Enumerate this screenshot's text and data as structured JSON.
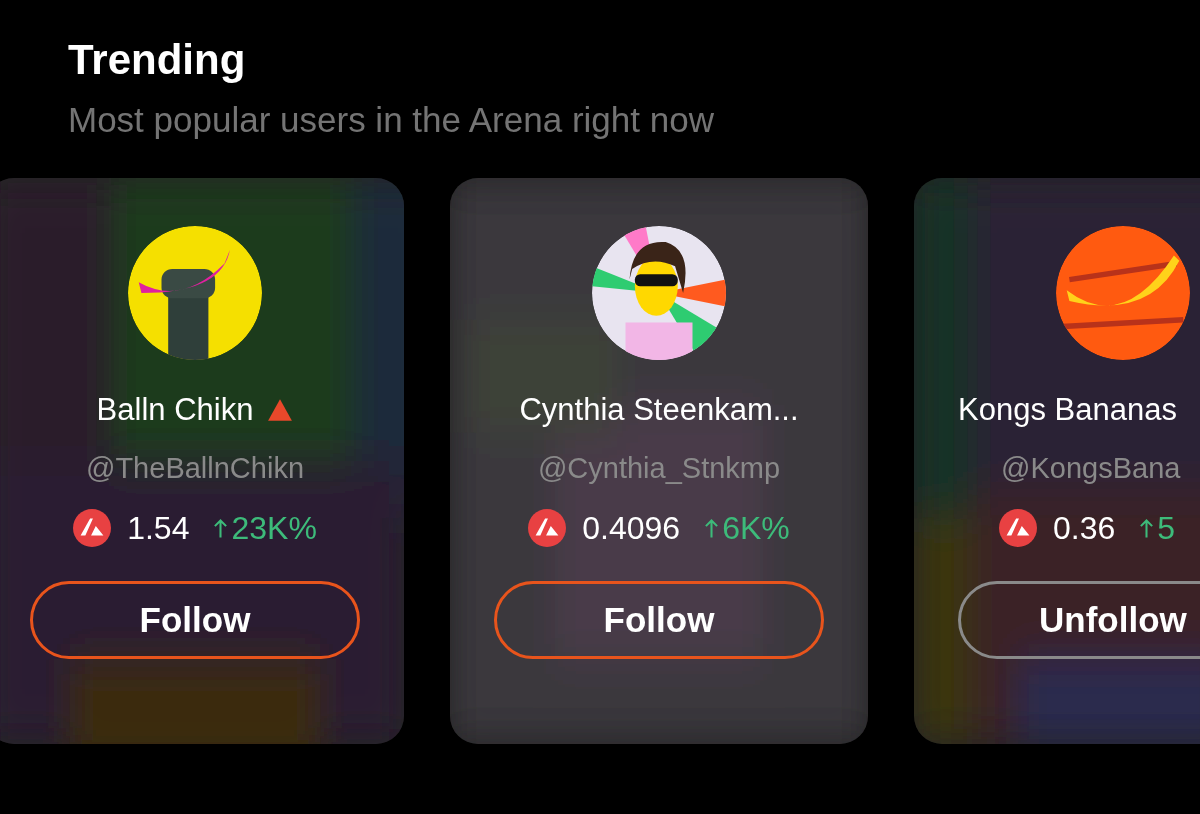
{
  "section": {
    "title": "Trending",
    "subtitle": "Most popular users in the Arena right now"
  },
  "cards": [
    {
      "name": "Balln Chikn",
      "badge": true,
      "handle": "@TheBallnChikn",
      "price": "1.54",
      "change": "23K%",
      "following": false,
      "button": "Follow"
    },
    {
      "name": "Cynthia Steenkam...",
      "badge": false,
      "handle": "@Cynthia_Stnkmp",
      "price": "0.4096",
      "change": "6K%",
      "following": false,
      "button": "Follow"
    },
    {
      "name": "Kongs Bananas",
      "badge": false,
      "handle": "@KongsBana",
      "price": "0.36",
      "change": "5",
      "following": true,
      "button": "Unfollow"
    }
  ]
}
